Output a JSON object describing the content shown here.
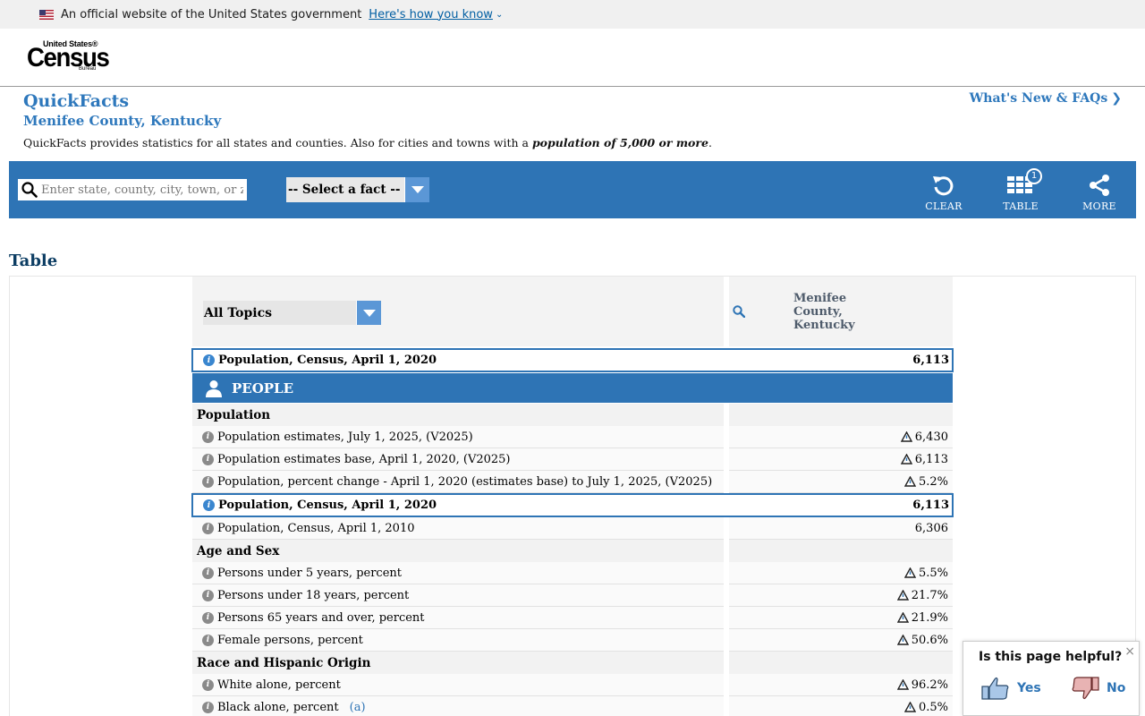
{
  "gov_banner": {
    "text": "An official website of the United States government",
    "link": "Here's how you know"
  },
  "logo": {
    "top": "United States®",
    "main": "Census",
    "bottom": "Bureau"
  },
  "page": {
    "title": "QuickFacts",
    "subtitle": "Menifee County, Kentucky",
    "description_prefix": "QuickFacts provides statistics for all states and counties. Also for cities and towns with a ",
    "description_emphasis": "population of 5,000 or more",
    "description_suffix": ".",
    "whats_new": "What's New & FAQs"
  },
  "toolbar": {
    "search_placeholder": "Enter state, county, city, town, or zip code",
    "fact_select": "-- Select a fact --",
    "clear_label": "CLEAR",
    "table_label": "TABLE",
    "table_badge": "1",
    "more_label": "MORE"
  },
  "table": {
    "heading": "Table",
    "topics_select": "All Topics",
    "column_title": "Menifee County, Kentucky",
    "pinned_row": {
      "label": "Population, Census, April 1, 2020",
      "value": "6,113"
    },
    "people_band": "PEOPLE",
    "population_header": "Population",
    "population_rows": [
      {
        "label": "Population estimates, July 1, 2025, (V2025)",
        "value": "6,430"
      },
      {
        "label": "Population estimates base, April 1, 2020, (V2025)",
        "value": "6,113"
      },
      {
        "label": "Population, percent change - April 1, 2020 (estimates base) to July 1, 2025, (V2025)",
        "value": "5.2%"
      },
      {
        "label": "Population, Census, April 1, 2020",
        "value": "6,113"
      },
      {
        "label": "Population, Census, April 1, 2010",
        "value": "6,306"
      }
    ],
    "age_header": "Age and Sex",
    "age_rows": [
      {
        "label": "Persons under 5 years, percent",
        "value": "5.5%"
      },
      {
        "label": "Persons under 18 years, percent",
        "value": "21.7%"
      },
      {
        "label": "Persons 65 years and over, percent",
        "value": "21.9%"
      },
      {
        "label": "Female persons, percent",
        "value": "50.6%"
      }
    ],
    "race_header": "Race and Hispanic Origin",
    "race_rows": [
      {
        "label": "White alone, percent",
        "value": "96.2%"
      },
      {
        "label": "Black alone, percent",
        "footnote": "(a)",
        "value": "0.5%"
      }
    ]
  },
  "feedback": {
    "question": "Is this page helpful?",
    "yes": "Yes",
    "no": "No",
    "close": "×"
  },
  "colors": {
    "brand_blue": "#2e74b5",
    "title_blue": "#2e78bc",
    "heading_navy": "#0c3d63"
  }
}
